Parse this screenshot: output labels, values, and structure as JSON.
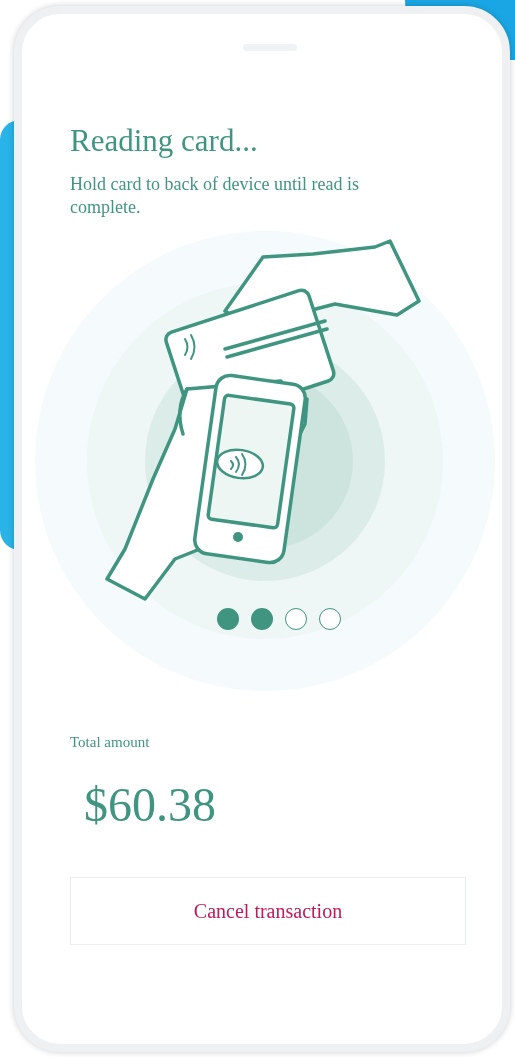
{
  "screen": {
    "title": "Reading card...",
    "instruction": "Hold card to back of device until read is complete."
  },
  "progress_dots": [
    {
      "filled": true
    },
    {
      "filled": true
    },
    {
      "filled": false
    },
    {
      "filled": false
    }
  ],
  "total": {
    "label": "Total amount",
    "amount": "$60.38"
  },
  "cancel_button": {
    "label": "Cancel transaction"
  }
}
